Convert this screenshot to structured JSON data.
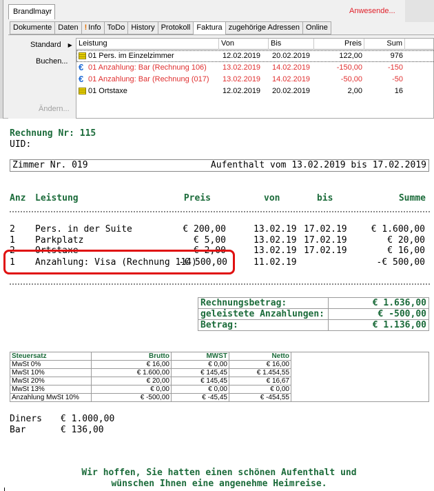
{
  "window": {
    "name_tab": "Brandlmayr",
    "attendees_label": "Anwesende...",
    "tabs": [
      "Dokumente",
      "Daten",
      "Info",
      "ToDo",
      "History",
      "Protokoll",
      "Faktura",
      "zugehörige Adressen",
      "Online"
    ],
    "active_tab": "Faktura",
    "side_buttons": {
      "standard": "Standard",
      "buchen": "Buchen...",
      "aendern": "Ändern..."
    },
    "grid": {
      "columns": [
        "Leistung",
        "Von",
        "Bis",
        "Preis",
        "Sum"
      ],
      "rows": [
        {
          "icon": "yellow-list-icon",
          "leistung": "01  Pers. im Einzelzimmer",
          "von": "12.02.2019",
          "bis": "20.02.2019",
          "preis": "122,00",
          "sum": "976",
          "style": "normal"
        },
        {
          "icon": "euro-icon",
          "leistung": "01  Anzahlung: Bar (Rechnung 106)",
          "von": "13.02.2019",
          "bis": "14.02.2019",
          "preis": "-150,00",
          "sum": "-150",
          "style": "red"
        },
        {
          "icon": "euro-icon",
          "leistung": "01  Anzahlung: Bar (Rechnung  (017)",
          "von": "13.02.2019",
          "bis": "14.02.2019",
          "preis": "-50,00",
          "sum": "-50",
          "style": "red"
        },
        {
          "icon": "yellow-list-icon",
          "leistung": "01  Ortstaxe",
          "von": "12.02.2019",
          "bis": "20.02.2019",
          "preis": "2,00",
          "sum": "16",
          "style": "normal"
        }
      ]
    }
  },
  "invoice": {
    "title": "Rechnung Nr: 115",
    "uid": "UID:",
    "room": "Zimmer Nr. 019",
    "stay": "Aufenthalt vom 13.02.2019 bis 17.02.2019",
    "headers": {
      "anz": "Anz",
      "leistung": "Leistung",
      "preis": "Preis",
      "von": "von",
      "bis": "bis",
      "summe": "Summe"
    },
    "lines": [
      {
        "anz": "2",
        "leistung": "Pers. in der Suite",
        "preis": "€ 200,00",
        "von": "13.02.19",
        "bis": "17.02.19",
        "summe": "€ 1.600,00"
      },
      {
        "anz": "1",
        "leistung": "Parkplatz",
        "preis": "€ 5,00",
        "von": "13.02.19",
        "bis": "17.02.19",
        "summe": "€ 20,00"
      },
      {
        "anz": "2",
        "leistung": "Ortstaxe",
        "preis": "€ 2,00",
        "von": "13.02.19",
        "bis": "17.02.19",
        "summe": "€ 16,00"
      },
      {
        "anz": "1",
        "leistung": "Anzahlung: Visa (Rechnung 114)",
        "preis": "-€ 500,00",
        "von": "11.02.19",
        "bis": "",
        "summe": "-€ 500,00"
      }
    ],
    "totals": [
      {
        "label": "Rechnungsbetrag:",
        "value": "€ 1.636,00"
      },
      {
        "label": "geleistete Anzahlungen:",
        "value": "€ -500,00"
      },
      {
        "label": "Betrag:",
        "value": "€ 1.136,00"
      }
    ],
    "tax": {
      "headers": [
        "Steuersatz",
        "Brutto",
        "MWST",
        "Netto"
      ],
      "rows": [
        [
          "MwSt 0%",
          "€ 16,00",
          "€ 0,00",
          "€ 16,00"
        ],
        [
          "MwSt 10%",
          "€ 1.600,00",
          "€ 145,45",
          "€ 1.454,55"
        ],
        [
          "MwSt 20%",
          "€ 20,00",
          "€ 145,45",
          "€ 16,67"
        ],
        [
          "MwSt 13%",
          "€ 0,00",
          "€ 0,00",
          "€ 0,00"
        ],
        [
          "Anzahlung MwSt 10%",
          "€ -500,00",
          "€ -45,45",
          "€ -454,55"
        ]
      ]
    },
    "payments": [
      {
        "method": "Diners",
        "amount": "€ 1.000,00"
      },
      {
        "method": "Bar",
        "amount": "€ 136,00"
      }
    ],
    "closing_line1": "Wir hoffen, Sie hatten einen schönen Aufenthalt und",
    "closing_line2": "wünschen Ihnen eine angenehme Heimreise.",
    "colors": {
      "accent_green": "#1b6b3a",
      "highlight_red": "#e01010",
      "grid_red_text": "#e03030"
    }
  }
}
